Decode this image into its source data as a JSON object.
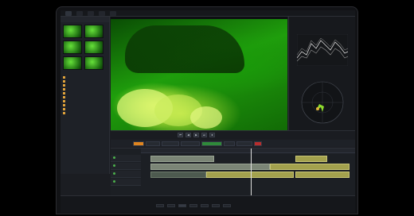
{
  "app": {
    "top_tabs": [
      "",
      "",
      "",
      "",
      ""
    ]
  },
  "media_panel": {
    "title": "",
    "thumbs": [
      {
        "caption": ""
      },
      {
        "caption": ""
      },
      {
        "caption": ""
      },
      {
        "caption": ""
      },
      {
        "caption": ""
      },
      {
        "caption": ""
      },
      {
        "caption": ""
      }
    ],
    "tree": [
      "",
      "",
      "",
      "",
      "",
      "",
      "",
      "",
      "",
      ""
    ]
  },
  "transport": {
    "timecode": "",
    "buttons": [
      "⏮",
      "◀",
      "▶",
      "⏭",
      "⏹"
    ],
    "timecode_right": ""
  },
  "toolbar": {
    "tools": [
      {
        "label": "",
        "style": "orange"
      },
      {
        "label": "",
        "style": ""
      },
      {
        "label": "",
        "style": ""
      },
      {
        "label": "",
        "style": ""
      },
      {
        "label": "",
        "style": "green"
      },
      {
        "label": "",
        "style": ""
      },
      {
        "label": "",
        "style": ""
      },
      {
        "label": "",
        "style": "red"
      }
    ]
  },
  "timeline": {
    "tracks": [
      "",
      "",
      "",
      ""
    ],
    "clips": [
      "",
      "",
      "",
      "",
      "",
      "",
      ""
    ]
  },
  "dock": {
    "items": [
      "",
      "",
      "",
      "",
      "",
      "",
      ""
    ]
  },
  "colors": {
    "accent_orange": "#e0851f",
    "accent_green": "#2f8a3a",
    "accent_red": "#b82d2d",
    "clip_yellow": "#a3a14d",
    "timecode_red": "#e34040"
  }
}
